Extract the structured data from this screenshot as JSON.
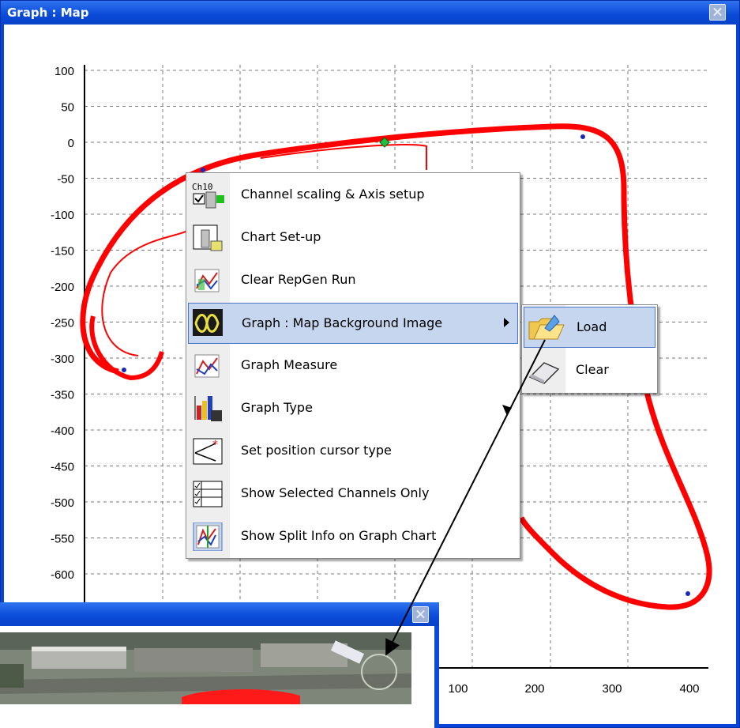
{
  "window": {
    "title": "Graph : Map"
  },
  "chart_data": {
    "type": "scatter",
    "title": "",
    "xlabel": "",
    "ylabel": "",
    "y_ticks": [
      "100",
      "50",
      "0",
      "-50",
      "-100",
      "-150",
      "-200",
      "-250",
      "-300",
      "-350",
      "-400",
      "-450",
      "-500",
      "-550",
      "-600"
    ],
    "x_ticks": [
      "100",
      "200",
      "300",
      "400"
    ],
    "ylim": [
      -650,
      100
    ],
    "grid": true,
    "series": [
      {
        "color": "#ff0000",
        "x": [
          -50,
          -30,
          20,
          100,
          180,
          240,
          290,
          330,
          360,
          380,
          400,
          420,
          440,
          430,
          400,
          350,
          300,
          250,
          200,
          170,
          160
        ],
        "y": [
          -300,
          -280,
          -120,
          -20,
          10,
          20,
          10,
          -100,
          -250,
          -450,
          -600,
          -650,
          -600,
          -550,
          -500,
          -470,
          -450,
          -440,
          -430,
          -420,
          -410
        ]
      }
    ]
  },
  "context_menu": {
    "items": [
      {
        "label": "Channel scaling & Axis setup",
        "icon": "channel-scaling-icon"
      },
      {
        "label": "Chart Set-up",
        "icon": "chart-setup-icon"
      },
      {
        "label": "Clear RepGen Run",
        "icon": "clear-repgen-icon"
      },
      {
        "label": "Graph : Map Background Image",
        "icon": "map-background-icon"
      },
      {
        "label": "Graph Measure",
        "icon": "graph-measure-icon"
      },
      {
        "label": "Graph Type",
        "icon": "graph-type-icon"
      },
      {
        "label": "Set position cursor type",
        "icon": "cursor-type-icon"
      },
      {
        "label": "Show Selected Channels Only",
        "icon": "selected-channels-icon"
      },
      {
        "label": "Show Split Info on Graph Chart",
        "icon": "split-info-icon"
      }
    ],
    "ch_label": "Ch10"
  },
  "submenu": {
    "items": [
      {
        "label": "Load",
        "icon": "folder-open-icon"
      },
      {
        "label": "Clear",
        "icon": "eraser-icon"
      }
    ]
  },
  "colors": {
    "titlebar": "#0a4ad8",
    "trace": "#ff0000",
    "menu_highlight": "#c6d6ef"
  }
}
